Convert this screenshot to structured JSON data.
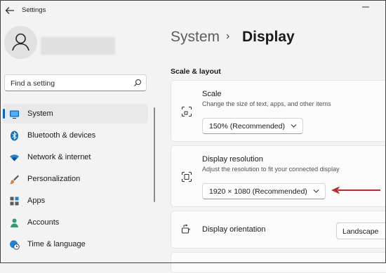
{
  "window": {
    "title": "Settings"
  },
  "search": {
    "placeholder": "Find a setting"
  },
  "sidebar": {
    "items": [
      {
        "label": "System",
        "icon": "monitor-icon",
        "active": true
      },
      {
        "label": "Bluetooth & devices",
        "icon": "bluetooth-icon"
      },
      {
        "label": "Network & internet",
        "icon": "wifi-icon"
      },
      {
        "label": "Personalization",
        "icon": "brush-icon"
      },
      {
        "label": "Apps",
        "icon": "apps-icon"
      },
      {
        "label": "Accounts",
        "icon": "person-icon"
      },
      {
        "label": "Time & language",
        "icon": "globe-clock-icon"
      }
    ]
  },
  "breadcrumb": {
    "parent": "System",
    "separator": "›",
    "current": "Display"
  },
  "section": {
    "heading": "Scale & layout"
  },
  "settings": {
    "scale": {
      "title": "Scale",
      "description": "Change the size of text, apps, and other items",
      "value": "150% (Recommended)"
    },
    "resolution": {
      "title": "Display resolution",
      "description": "Adjust the resolution to fit your connected display",
      "value": "1920 × 1080 (Recommended)"
    },
    "orientation": {
      "title": "Display orientation",
      "value": "Landscape"
    }
  },
  "colors": {
    "accent": "#0067c0",
    "annotation_arrow": "#c0282d"
  }
}
